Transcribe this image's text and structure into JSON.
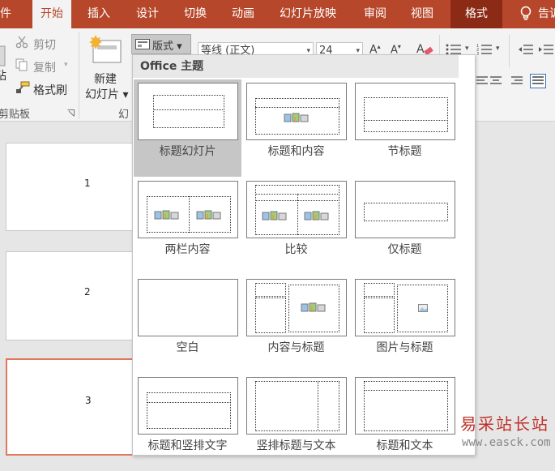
{
  "tabs": [
    "件",
    "开始",
    "插入",
    "设计",
    "切换",
    "动画",
    "幻灯片放映",
    "审阅",
    "视图",
    "格式",
    "告诉"
  ],
  "ribbon": {
    "cut": "剪切",
    "copy": "复制",
    "format_painter": "格式刷",
    "paste_fragment": "粘",
    "new_slide_line1": "新建",
    "new_slide_line2": "幻灯片 ▾",
    "slides_group_fragment": "幻",
    "clipboard_group": "剪贴板",
    "layout_button": "版式 ▾",
    "font_name": "等线 (正文)",
    "font_size": "24"
  },
  "slides": [
    "1",
    "2",
    "3"
  ],
  "layout_menu": {
    "header": "Office 主题",
    "layouts": [
      "标题幻灯片",
      "标题和内容",
      "节标题",
      "两栏内容",
      "比较",
      "仅标题",
      "空白",
      "内容与标题",
      "图片与标题",
      "标题和竖排文字",
      "竖排标题与文本",
      "标题和文本"
    ],
    "selected_index": 0
  },
  "watermark": {
    "title": "易采站长站",
    "url": "www.easck.com"
  },
  "colors": {
    "accent": "#b7472a",
    "format_tab": "#8c2b15",
    "selection_border": "#e0785c",
    "menu_selected": "#c6c6c6"
  }
}
